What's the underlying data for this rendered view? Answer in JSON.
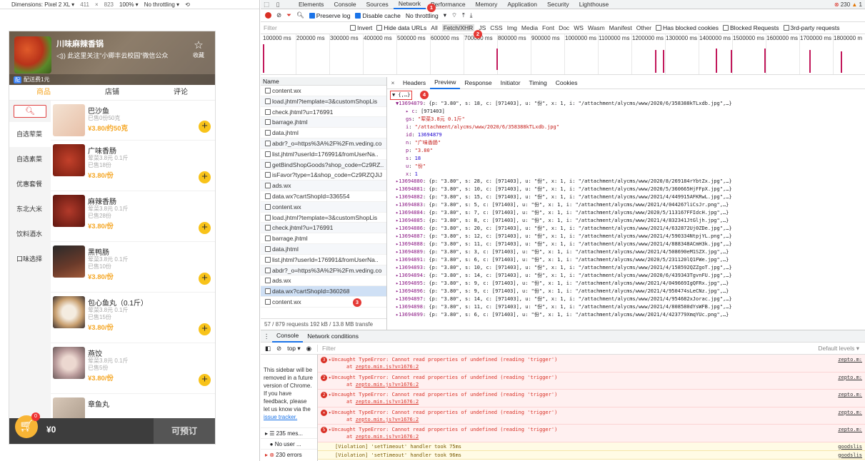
{
  "emulator": {
    "device": "Dimensions: Pixel 2 XL ▾",
    "width": "411",
    "times": "×",
    "height": "823",
    "zoom": "100% ▾",
    "throttle": "No throttling ▾"
  },
  "shop": {
    "name": "川味麻辣香锅",
    "notice": "◁)) 此这里关注“小卿丰云校园”微信公众",
    "fav_label": "收藏",
    "promo_badge": "配",
    "promo_text": "配送费1元",
    "tabs": [
      "商品",
      "店铺",
      "评论"
    ],
    "categories": [
      "自选荤菜",
      "自选素菜",
      "优惠套餐",
      "东北大米",
      "饮料酒水",
      "口味选择"
    ],
    "goods": [
      {
        "name": "巴沙鱼",
        "sub1": "已售0份50克",
        "sub2": "",
        "sub3": "",
        "price": "¥3.80/约50克"
      },
      {
        "name": "广味香肠",
        "sub1": "荤菜3.8元 0.1斤",
        "sub2": "已售18份",
        "sub3": "",
        "price": "¥3.80/份"
      },
      {
        "name": "麻辣香肠",
        "sub1": "荤菜3.8元 0.1斤",
        "sub2": "已售28份",
        "sub3": "",
        "price": "¥3.80/份"
      },
      {
        "name": "黑鸭肠",
        "sub1": "荤菜3.8元 0.1斤",
        "sub2": "已售10份",
        "sub3": "",
        "price": "¥3.80/份"
      },
      {
        "name": "包心鱼丸（0.1斤）",
        "sub1": "荤菜3.8元 0.1斤",
        "sub2": "已售15份",
        "sub3": "",
        "price": "¥3.80/份"
      },
      {
        "name": "燕饺",
        "sub1": "荤菜3.8元 0.1斤",
        "sub2": "已售5份",
        "sub3": "",
        "price": "¥3.80/份"
      },
      {
        "name": "章鱼丸",
        "sub1": "",
        "sub2": "",
        "sub3": "",
        "price": ""
      }
    ],
    "cart_count": "0",
    "cart_total": "¥0",
    "order_btn": "可预订"
  },
  "devtools": {
    "tabs": [
      "Elements",
      "Console",
      "Sources",
      "Network",
      "Performance",
      "Memory",
      "Application",
      "Security",
      "Lighthouse"
    ],
    "active_tab": "Network",
    "errors": "230",
    "warnings": "1",
    "toolbar": {
      "preserve_log": "Preserve log",
      "disable_cache": "Disable cache",
      "throttling": "No throttling"
    },
    "filter": {
      "placeholder": "Filter",
      "invert": "Invert",
      "hide_data_urls": "Hide data URLs",
      "types": [
        "All",
        "Fetch/XHR",
        "JS",
        "CSS",
        "Img",
        "Media",
        "Font",
        "Doc",
        "WS",
        "Wasm",
        "Manifest",
        "Other"
      ],
      "blocked_cookies": "Has blocked cookies",
      "blocked_requests": "Blocked Requests",
      "third_party": "3rd-party requests"
    },
    "timeline_labels": [
      "100000 ms",
      "200000 ms",
      "300000 ms",
      "400000 ms",
      "500000 ms",
      "600000 ms",
      "700000 ms",
      "800000 ms",
      "900000 ms",
      "1000000 ms",
      "1100000 ms",
      "1200000 ms",
      "1300000 ms",
      "1400000 ms",
      "1500000 ms",
      "1600000 ms",
      "1700000 ms",
      "1800000 m"
    ],
    "request_col": "Name",
    "requests": [
      "content.wx",
      "load.jhtml?template=3&customShopLis",
      "check.jhtml?u=176991",
      "barrage.jhtml",
      "data.jhtml",
      "abdr?_o=https%3A%2F%2Fm.veding.co",
      "list.jhtml?userId=176991&fromUserNa..",
      "getBindShopGoods?shop_code=Cz9RZ..",
      "isFavor?type=1&shop_code=Cz9RZQJiJ",
      "ads.wx",
      "data.wx?cartShopId=336554",
      "content.wx",
      "load.jhtml?template=3&customShopLis",
      "check.jhtml?u=176991",
      "barrage.jhtml",
      "data.jhtml",
      "list.jhtml?userId=176991&fromUserNa..",
      "abdr?_o=https%3A%2F%2Fm.veding.co",
      "ads.wx",
      "data.wx?cartShopId=360268",
      "content.wx"
    ],
    "summary": "57 / 879 requests   192 kB / 13.8 MB transfe",
    "detail_tabs": [
      "Headers",
      "Preview",
      "Response",
      "Initiator",
      "Timing",
      "Cookies"
    ],
    "preview": {
      "root": "▼ {,…}",
      "first_key": "▼13694879",
      "first_summary": ": {p: \"3.80\", s: 18, c: [971403], u: \"份\", x: 1, i: \"/attachment/alycms/www/2020/6/358388kTLxdb.jpg\",…}",
      "expanded": [
        {
          "k": "▸ c",
          "v": "[971403]",
          "type": "plain"
        },
        {
          "k": "gs",
          "v": "\"荤菜3.8元 0.1斤\"",
          "type": "str"
        },
        {
          "k": "i",
          "v": "\"/attachment/alycms/www/2020/6/358388kTLxdb.jpg\"",
          "type": "str"
        },
        {
          "k": "id",
          "v": "13694879",
          "type": "num"
        },
        {
          "k": "n",
          "v": "\"广味香肠\"",
          "type": "str"
        },
        {
          "k": "p",
          "v": "\"3.80\"",
          "type": "str"
        },
        {
          "k": "s",
          "v": "18",
          "type": "num"
        },
        {
          "k": "u",
          "v": "\"份\"",
          "type": "str"
        },
        {
          "k": "x",
          "v": "1",
          "type": "num"
        }
      ],
      "rows": [
        {
          "id": "13694880",
          "rest": ": {p: \"3.80\", s: 28, c: [971403], u: \"份\", x: 1, i: \"/attachment/alycms/www/2020/8/269184rYbtZx.jpg\",…}"
        },
        {
          "id": "13694881",
          "rest": ": {p: \"3.80\", s: 10, c: [971403], u: \"份\", x: 1, i: \"/attachment/alycms/www/2020/5/360665HjFFpX.jpg\",…}"
        },
        {
          "id": "13694882",
          "rest": ": {p: \"3.80\", s: 15, c: [971403], u: \"份\", x: 1, i: \"/attachment/alycms/www/2021/4/449915AFKRwL.jpg\",…}"
        },
        {
          "id": "13694883",
          "rest": ": {p: \"3.80\", s: 5, c: [971403], u: \"份\", x: 1, i: \"/attachment/alycms/www/2021/4/044267liCsJr.png\",…}"
        },
        {
          "id": "13694884",
          "rest": ": {p: \"3.80\", s: 7, c: [971403], u: \"份\", x: 1, i: \"/attachment/alycms/www/2020/5/113167FFIdcH.jpg\",…}"
        },
        {
          "id": "13694885",
          "rest": ": {p: \"3.80\", s: 8, c: [971403], u: \"份\", x: 1, i: \"/attachment/alycms/www/2021/4/832341JtGljh.jpg\",…}"
        },
        {
          "id": "13694886",
          "rest": ": {p: \"3.80\", s: 20, c: [971403], u: \"份\", x: 1, i: \"/attachment/alycms/www/2021/4/632872Uj0ZDe.jpg\",…}"
        },
        {
          "id": "13694887",
          "rest": ": {p: \"3.80\", s: 12, c: [971403], u: \"份\", x: 1, i: \"/attachment/alycms/www/2021/4/590334NtpjYL.png\",…}"
        },
        {
          "id": "13694888",
          "rest": ": {p: \"3.80\", s: 11, c: [971403], u: \"份\", x: 1, i: \"/attachment/alycms/www/2021/4/888348ACmH3k.jpg\",…}"
        },
        {
          "id": "13694889",
          "rest": ": {p: \"3.80\", s: 3, c: [971403], u: \"份\", x: 1, i: \"/attachment/alycms/www/2021/4/508690eM1SZX.jpg\",…}"
        },
        {
          "id": "13694891",
          "rest": ": {p: \"3.80\", s: 6, c: [971403], u: \"份\", x: 1, i: \"/attachment/alycms/www/2020/5/231120lQ1FWe.jpg\",…}"
        },
        {
          "id": "13694893",
          "rest": ": {p: \"3.80\", s: 10, c: [971403], u: \"份\", x: 1, i: \"/attachment/alycms/www/2021/4/158592QZZgoT.jpg\",…}"
        },
        {
          "id": "13694894",
          "rest": ": {p: \"3.80\", s: 14, c: [971403], u: \"份\", x: 1, i: \"/attachment/alycms/www/2020/6/439343TgvnFU.jpg\",…}"
        },
        {
          "id": "13694895",
          "rest": ": {p: \"3.80\", s: 9, c: [971403], u: \"份\", x: 1, i: \"/attachment/alycms/www/2021/4/049669IgQFRx.jpg\",…}"
        },
        {
          "id": "13694896",
          "rest": ": {p: \"3.80\", s: 9, c: [971403], u: \"份\", x: 1, i: \"/attachment/alycms/www/2021/4/950474sLeCNz.jpg\",…}"
        },
        {
          "id": "13694897",
          "rest": ": {p: \"3.80\", s: 14, c: [971403], u: \"份\", x: 1, i: \"/attachment/alycms/www/2021/4/954682xJorac.jpg\",…}"
        },
        {
          "id": "13694898",
          "rest": ": {p: \"3.80\", s: 11, c: [971403], u: \"份\", x: 1, i: \"/attachment/alycms/www/2021/4/808580dYsWFB.jpg\",…}"
        },
        {
          "id": "13694899",
          "rest": ": {p: \"3.80\", s: 6, c: [971403], u: \"份\", x: 1, i: \"/attachment/alycms/www/2021/4/423779XmqYUc.png\",…}"
        }
      ]
    },
    "console": {
      "tabs": [
        "Console",
        "Network conditions"
      ],
      "context": "top ▾",
      "filter_placeholder": "Filter",
      "levels": "Default levels ▾",
      "sidebar_note": "This sidebar will be removed in a future version of Chrome. If you have feedback, please let us know via the",
      "issue_link": "issue tracker.",
      "side_messages": "235 mes...",
      "side_user": "No user ...",
      "side_errors": "230 errors",
      "errors": [
        {
          "count": "3",
          "text": "▸Uncaught TypeError: Cannot read properties of undefined (reading 'trigger')",
          "at": "at",
          "loc": "zepto.min.js?v=1676:2",
          "src": "zepto.m:"
        },
        {
          "count": "2",
          "text": "▸Uncaught TypeError: Cannot read properties of undefined (reading 'trigger')",
          "at": "at",
          "loc": "zepto.min.js?v=1676:2",
          "src": "zepto.m:"
        },
        {
          "count": "2",
          "text": "▸Uncaught TypeError: Cannot read properties of undefined (reading 'trigger')",
          "at": "at",
          "loc": "zepto.min.js?v=1676:2",
          "src": "zepto.m:"
        },
        {
          "count": "✕",
          "text": "▸Uncaught TypeError: Cannot read properties of undefined (reading 'trigger')",
          "at": "at",
          "loc": "zepto.min.js?v=1676:2",
          "src": "zepto.m:"
        },
        {
          "count": "5",
          "text": "▸Uncaught TypeError: Cannot read properties of undefined (reading 'trigger')",
          "at": "at",
          "loc": "zepto.min.js?v=1676:2",
          "src": "zepto.m:"
        }
      ],
      "violations": [
        {
          "text": "[Violation] 'setTimeout' handler took 75ms",
          "src": "goodslis"
        },
        {
          "text": "[Violation] 'setTimeout' handler took 96ms",
          "src": "goodslis"
        }
      ]
    },
    "markers": [
      "1",
      "2",
      "3",
      "4"
    ]
  },
  "colors": {
    "accent": "#1a73e8",
    "price": "#f5a623",
    "error": "#d93025",
    "marker": "#e53935"
  }
}
